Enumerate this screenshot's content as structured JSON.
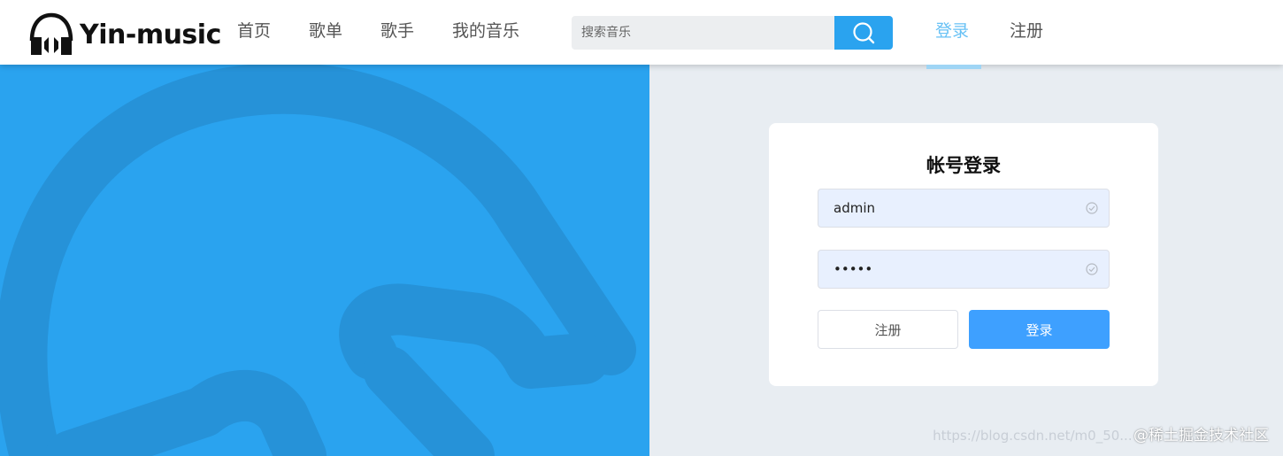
{
  "brand": {
    "name": "Yin-music"
  },
  "nav": {
    "items": [
      "首页",
      "歌单",
      "歌手",
      "我的音乐"
    ]
  },
  "search": {
    "placeholder": "搜索音乐"
  },
  "auth": {
    "login": "登录",
    "register": "注册"
  },
  "login_card": {
    "title": "帐号登录",
    "username": "admin",
    "password": "•••••",
    "register_button": "注册",
    "login_button": "登录"
  },
  "watermark": {
    "url": "https://blog.csdn.net/m0_50...",
    "text": "@稀土掘金技术社区"
  },
  "colors": {
    "brand_blue": "#2aa3ef",
    "active_link": "#67c1f5",
    "primary_button": "#3ea0ff",
    "page_background": "#e8edf2"
  },
  "icons": [
    "headphones-logo-icon",
    "search-icon",
    "valid-check-icon"
  ]
}
